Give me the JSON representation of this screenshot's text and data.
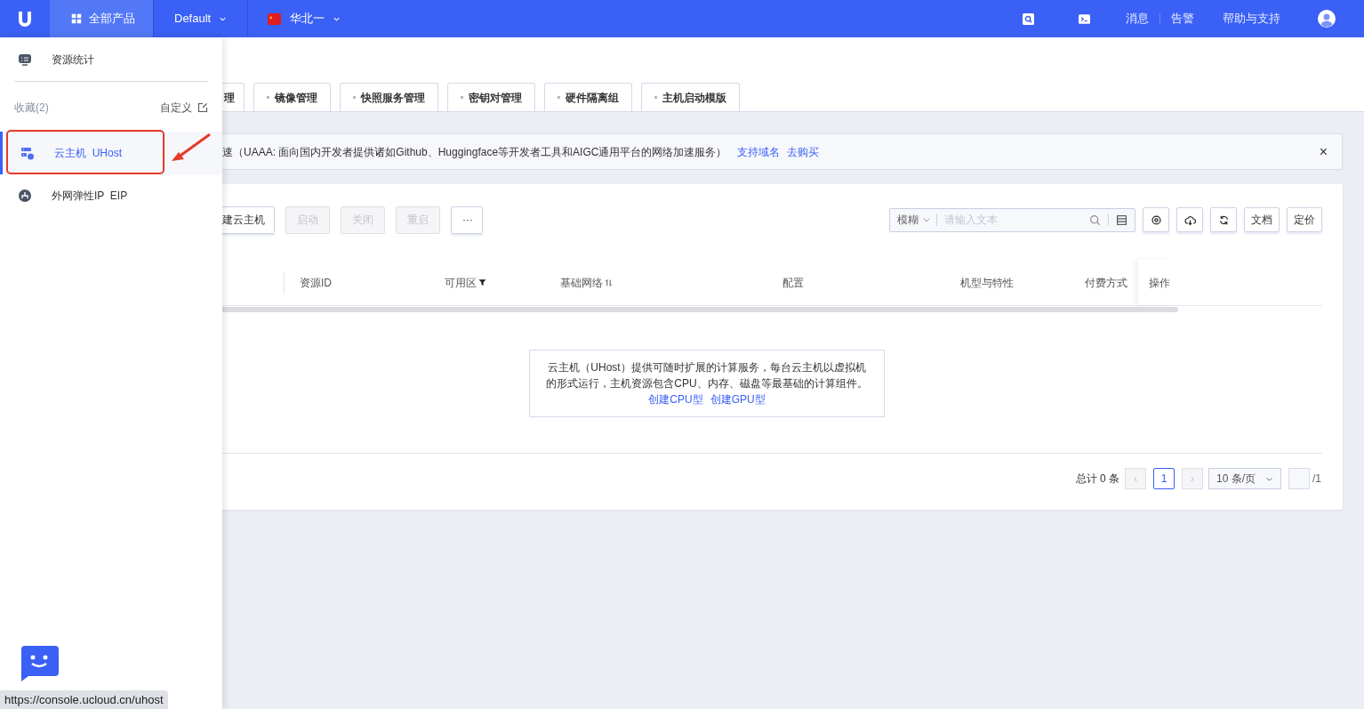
{
  "topbar": {
    "all_products": "全部产品",
    "project": "Default",
    "region": "华北一",
    "links": [
      "消息",
      "告警",
      "帮助与支持"
    ]
  },
  "sidebar": {
    "stats": "资源统计",
    "favorites_label": "收藏(2)",
    "customize": "自定义",
    "items": [
      {
        "kind": "server",
        "label": "云主机",
        "sublabel": "UHost",
        "selected": true,
        "highlighted": true
      },
      {
        "kind": "network",
        "label": "外网弹性IP",
        "sublabel": "EIP",
        "selected": false,
        "highlighted": false
      }
    ]
  },
  "tabs": [
    {
      "label": "理",
      "dot": false
    },
    {
      "label": "镜像管理",
      "dot": true
    },
    {
      "label": "快照服务管理",
      "dot": true
    },
    {
      "label": "密钥对管理",
      "dot": true
    },
    {
      "label": "硬件隔离组",
      "dot": true
    },
    {
      "label": "主机启动模版",
      "dot": true
    }
  ],
  "notice": {
    "text": "速（UAAA: 面向国内开发者提供诸如Github、Huggingface等开发者工具和AIGC通用平台的网络加速服务）",
    "links": [
      "支持域名",
      "去购买"
    ],
    "close": "×"
  },
  "toolbar": {
    "buttons": [
      {
        "label": "建云主机",
        "disabled": false
      },
      {
        "label": "启动",
        "disabled": true
      },
      {
        "label": "关闭",
        "disabled": true
      },
      {
        "label": "重启",
        "disabled": true
      },
      {
        "label": "···",
        "disabled": false
      }
    ],
    "search": {
      "mode": "模糊",
      "placeholder": "请输入文本"
    },
    "icon_buttons": [
      {
        "kind": "settings"
      },
      {
        "kind": "download"
      },
      {
        "kind": "refresh"
      }
    ],
    "text_buttons": [
      "文档",
      "定价"
    ]
  },
  "table": {
    "columns": [
      {
        "label": "资源ID",
        "kind": "plain"
      },
      {
        "label": "可用区",
        "kind": "filter"
      },
      {
        "label": "基础网络",
        "kind": "sort"
      },
      {
        "label": "配置",
        "kind": "plain"
      },
      {
        "label": "机型与特性",
        "kind": "plain"
      },
      {
        "label": "付费方式",
        "kind": "plain"
      },
      {
        "label": "操作",
        "kind": "plain"
      }
    ],
    "empty": {
      "text": "云主机（UHost）提供可随时扩展的计算服务，每台云主机以虚拟机的形式运行，主机资源包含CPU、内存、磁盘等最基础的计算组件。",
      "links": [
        "创建CPU型",
        "创建GPU型"
      ]
    }
  },
  "pagination": {
    "total": "总计 0 条",
    "prev": "‹",
    "page": "1",
    "next": "›",
    "page_size": "10 条/页",
    "total_pages": "/1"
  },
  "status_url": "https://console.ucloud.cn/uhost"
}
